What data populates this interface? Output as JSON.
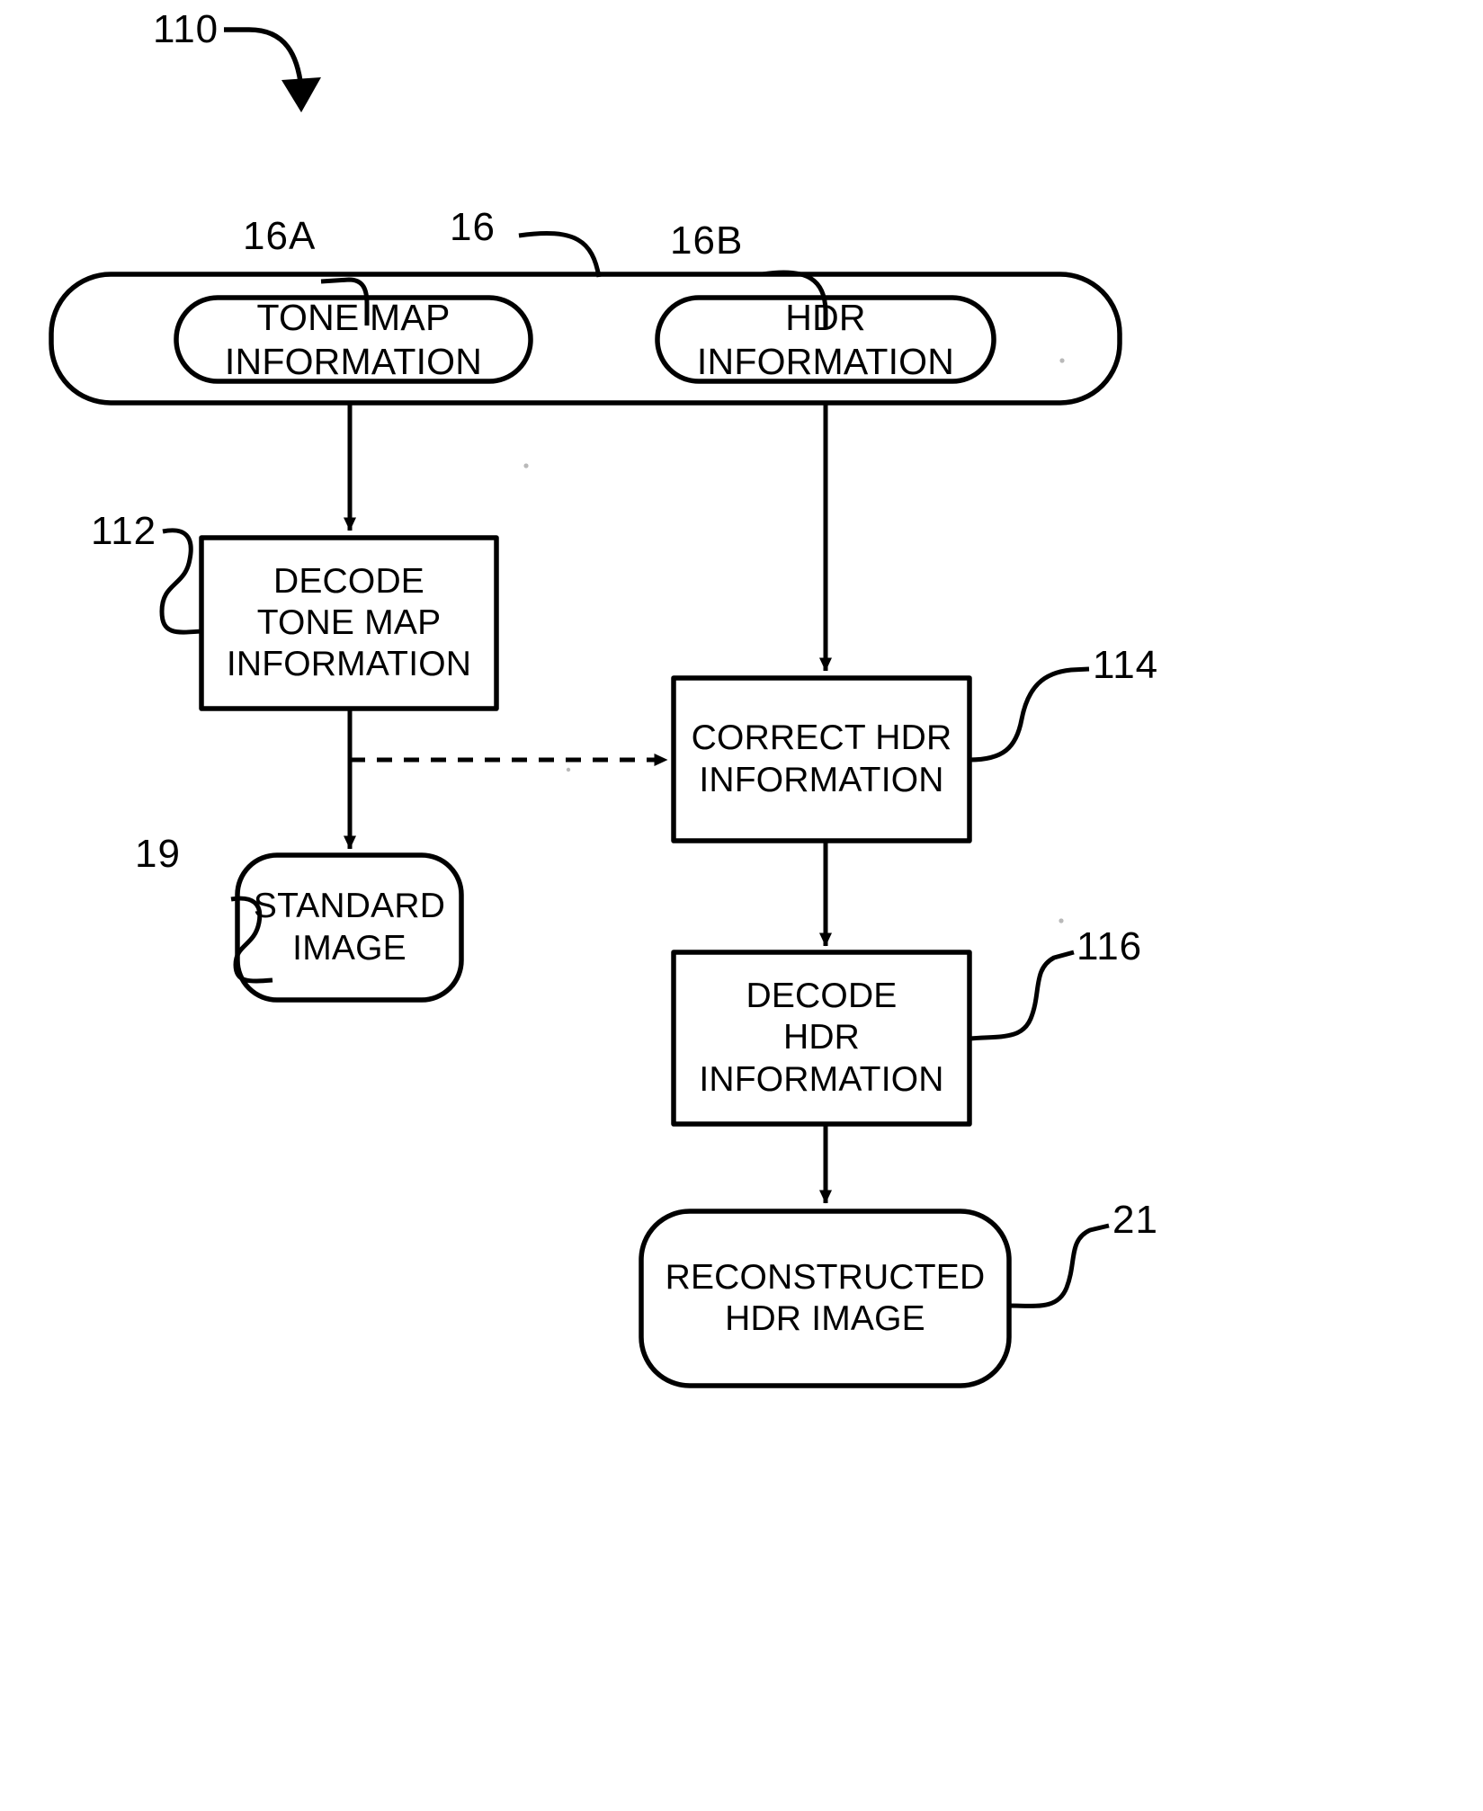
{
  "figure": {
    "reference_number": "110",
    "type": "patent-flowchart",
    "description": "HDR image decoding process flow"
  },
  "reference_numerals": {
    "figure": "110",
    "container": "16",
    "tone_map_info": "16A",
    "hdr_info": "16B",
    "decode_tone_map": "112",
    "correct_hdr": "114",
    "standard_image": "19",
    "decode_hdr": "116",
    "reconstructed_hdr_image": "21"
  },
  "nodes": {
    "container": {
      "ref": "16",
      "shape": "rounded-container"
    },
    "tone_map_information": {
      "ref": "16A",
      "shape": "stadium",
      "lines": [
        "TONE MAP",
        "INFORMATION"
      ]
    },
    "hdr_information": {
      "ref": "16B",
      "shape": "stadium",
      "lines": [
        "HDR",
        "INFORMATION"
      ]
    },
    "decode_tone_map_information": {
      "ref": "112",
      "shape": "rectangle",
      "lines": [
        "DECODE",
        "TONE MAP",
        "INFORMATION"
      ]
    },
    "correct_hdr_information": {
      "ref": "114",
      "shape": "rectangle",
      "lines": [
        "CORRECT HDR",
        "INFORMATION"
      ]
    },
    "standard_image": {
      "ref": "19",
      "shape": "rounded-rectangle",
      "lines": [
        "STANDARD",
        "IMAGE"
      ]
    },
    "decode_hdr_information": {
      "ref": "116",
      "shape": "rectangle",
      "lines": [
        "DECODE",
        "HDR",
        "INFORMATION"
      ]
    },
    "reconstructed_hdr_image": {
      "ref": "21",
      "shape": "rounded-rectangle",
      "lines": [
        "RECONSTRUCTED",
        "HDR IMAGE"
      ]
    }
  },
  "edges": [
    {
      "from": "tone_map_information",
      "to": "decode_tone_map_information",
      "style": "solid",
      "arrow": "filled"
    },
    {
      "from": "hdr_information",
      "to": "correct_hdr_information",
      "style": "solid",
      "arrow": "filled"
    },
    {
      "from": "decode_tone_map_information",
      "to": "correct_hdr_information",
      "style": "dashed",
      "arrow": "filled"
    },
    {
      "from": "decode_tone_map_information",
      "to": "standard_image",
      "style": "solid",
      "arrow": "filled"
    },
    {
      "from": "correct_hdr_information",
      "to": "decode_hdr_information",
      "style": "solid",
      "arrow": "filled"
    },
    {
      "from": "decode_hdr_information",
      "to": "reconstructed_hdr_image",
      "style": "solid",
      "arrow": "filled"
    }
  ],
  "colors": {
    "stroke": "#000000",
    "background": "#ffffff",
    "text": "#000000"
  }
}
